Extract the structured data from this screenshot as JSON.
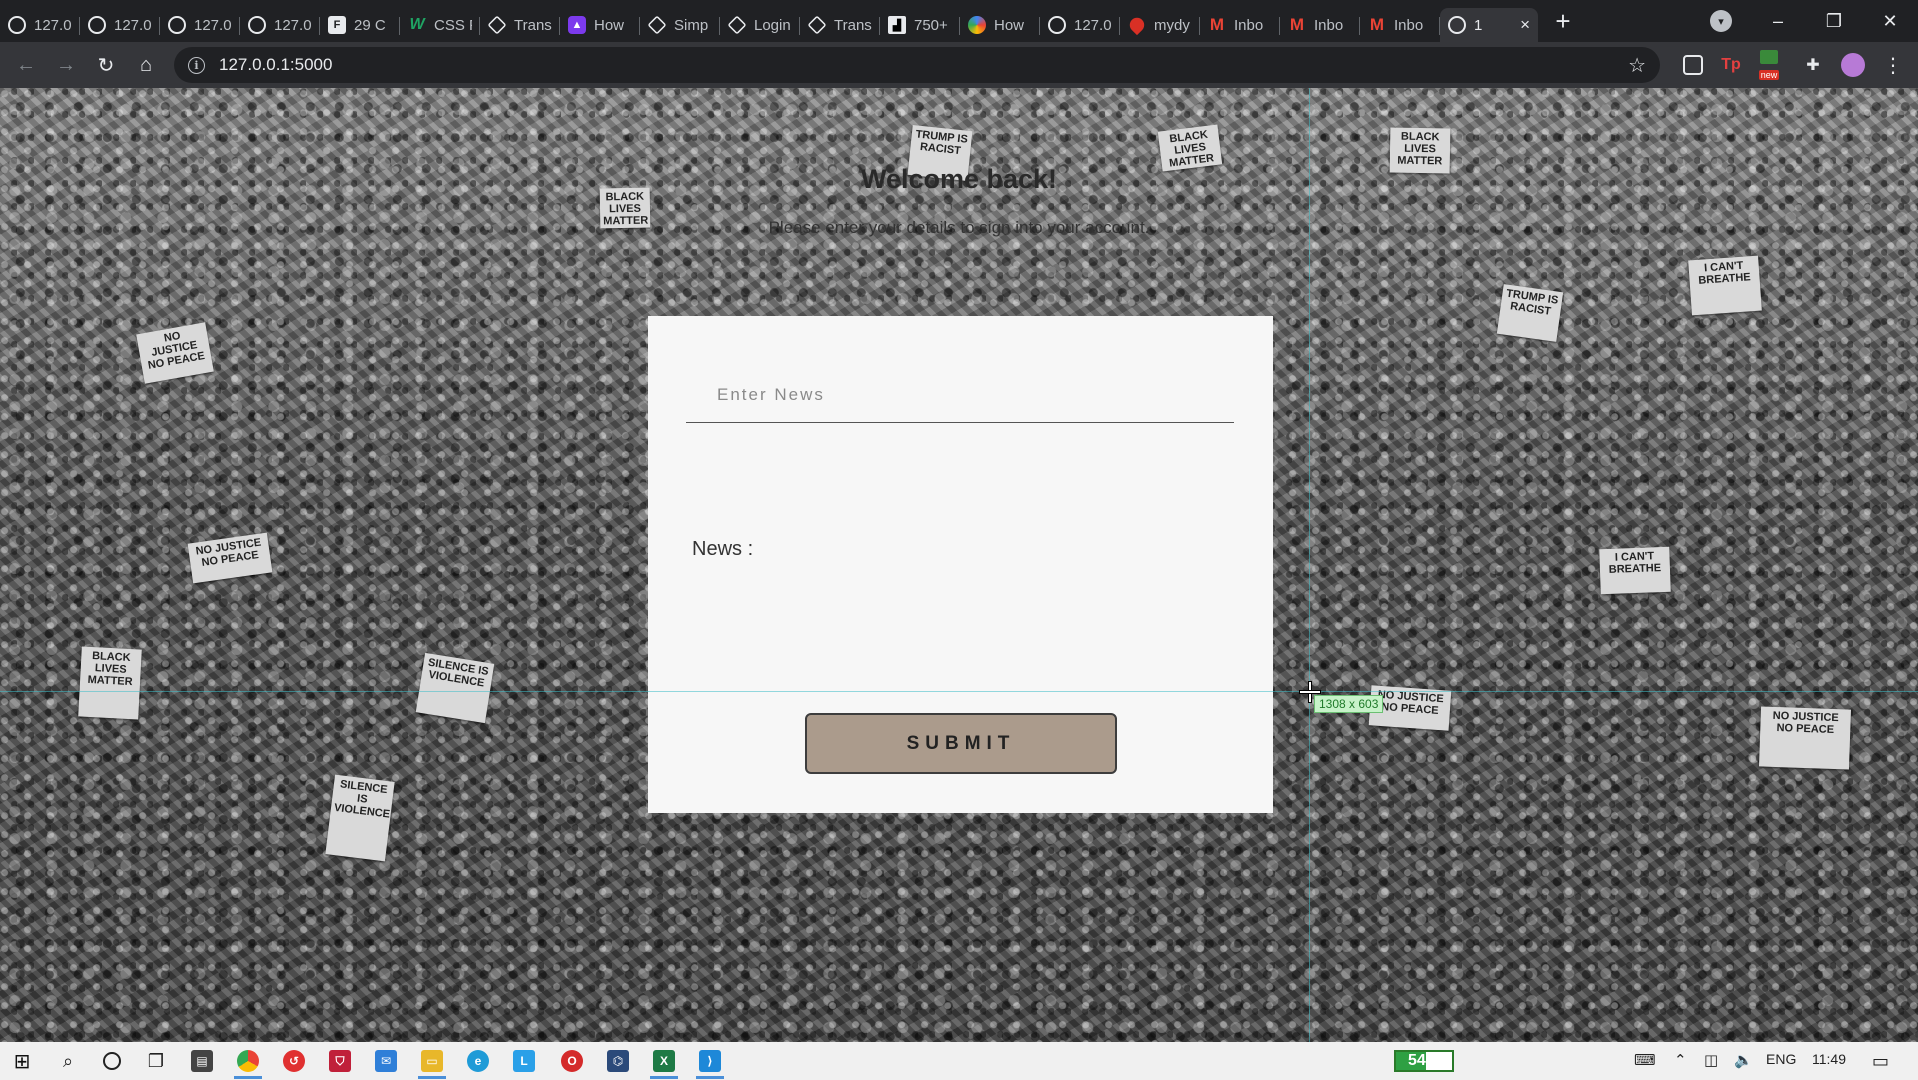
{
  "browser": {
    "tabs": [
      {
        "label": "127.0",
        "favicon": "globe"
      },
      {
        "label": "127.0",
        "favicon": "globe"
      },
      {
        "label": "127.0",
        "favicon": "globe"
      },
      {
        "label": "127.0",
        "favicon": "globe"
      },
      {
        "label": "29 C",
        "favicon": "F"
      },
      {
        "label": "CSS F",
        "favicon": "W"
      },
      {
        "label": "Trans",
        "favicon": "codepen"
      },
      {
        "label": "How",
        "favicon": "purple"
      },
      {
        "label": "Simp",
        "favicon": "codepen"
      },
      {
        "label": "Login",
        "favicon": "codepen"
      },
      {
        "label": "Trans",
        "favicon": "codepen"
      },
      {
        "label": "750+",
        "favicon": "dark"
      },
      {
        "label": "How",
        "favicon": "swirl"
      },
      {
        "label": "127.0",
        "favicon": "globe"
      },
      {
        "label": "mydy",
        "favicon": "red"
      },
      {
        "label": "Inbo",
        "favicon": "gmail"
      },
      {
        "label": "Inbo",
        "favicon": "gmail"
      },
      {
        "label": "Inbo",
        "favicon": "gmail"
      },
      {
        "label": "1",
        "favicon": "globe",
        "active": true
      }
    ],
    "new_tab_symbol": "+",
    "window_controls": {
      "minimize": "–",
      "restore": "❐",
      "close": "✕"
    },
    "address": {
      "url": "127.0.0.1:5000"
    },
    "extensions": {
      "new_badge": "new"
    }
  },
  "page": {
    "heading": "Welcome back!",
    "subtitle": "Please enter your details to sign into your account.",
    "form": {
      "news_placeholder": "Enter News",
      "news_value": "",
      "result_label": "News :",
      "result_value": "",
      "submit_label": "SUBMIT"
    },
    "devtools_size_badge": "1308 x 603"
  },
  "background_signs": [
    "NO JUSTICE NO PEACE",
    "TRUMP IS RACIST",
    "BLACK LIVES MATTER",
    "I CAN'T BREATHE",
    "BLACK LIVES MATTER",
    "SILENCE IS VIOLENCE",
    "NO JUSTICE NO PEACE",
    "BLACK LIVES MATTER"
  ],
  "taskbar": {
    "battery_percent": 54,
    "battery_label": "54%",
    "language": "ENG",
    "time": "11:49"
  },
  "colors": {
    "card_bg": "#f7f7f7",
    "submit_bg": "#ab9b8c",
    "guide": "#40bec8"
  }
}
